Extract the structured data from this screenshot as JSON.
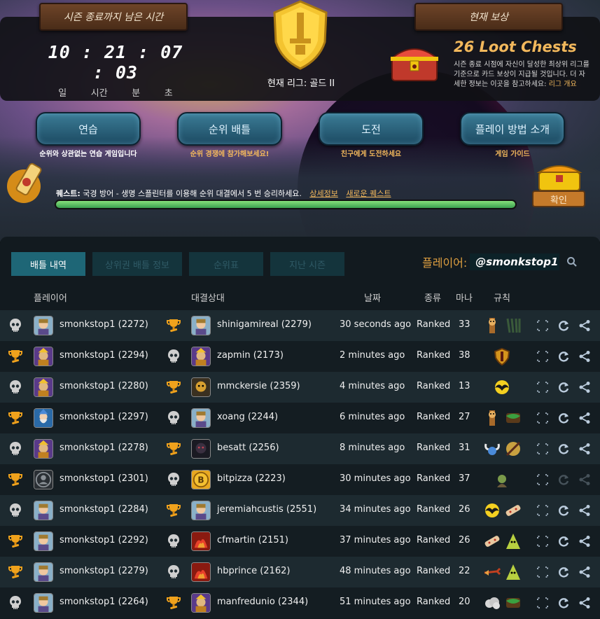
{
  "season": {
    "timer_label": "시즌 종료까지 남은 시간",
    "timer_value": "10 : 21 : 07 : 03",
    "units": [
      "일",
      "시간",
      "분",
      "초"
    ]
  },
  "league": {
    "current": "현재 리그: 골드 II"
  },
  "reward": {
    "header": "현재 보상",
    "title": "26 Loot Chests",
    "desc": "시즌 종료 시점에 자신이 달성한 최상위 리그를 기준으로 카드 보상이 지급될 것입니다. 더 자세한 정보는 이곳을 참고하세요: ",
    "link": "리그 개요"
  },
  "modes": [
    {
      "label": "연습",
      "desc": "순위와 상관없는 연습 게임입니다",
      "desc_color": "#ffffff"
    },
    {
      "label": "순위 배틀",
      "desc": "순위 경쟁에 참가해보세요!",
      "desc_color": "#f2b85c"
    },
    {
      "label": "도전",
      "desc": "친구에게 도전하세요",
      "desc_color": "#f2b85c"
    },
    {
      "label": "플레이 방법 소개",
      "desc": "게임 가이드",
      "desc_color": "#f2b85c"
    }
  ],
  "quest": {
    "label": "퀘스트:",
    "text": "국경 방어 - 생명 스플린터를 이용해 순위 대결에서 5 번 승리하세요.",
    "details_link": "상세정보",
    "new_link": "새로운 퀘스트",
    "progress": 1.0,
    "claim_label": "확인"
  },
  "tabs": [
    "배틀 내역",
    "상위권 배틀 정보",
    "순위표",
    "지난 시즌"
  ],
  "player_search": {
    "label": "플레이어:",
    "value": "@smonkstop1"
  },
  "table": {
    "headers": {
      "player": "플레이어",
      "opponent": "대결상대",
      "date": "날짜",
      "type": "종류",
      "mana": "마나",
      "rules": "규칙"
    },
    "rows": [
      {
        "player_result": "loss",
        "player": "smonkstop1 (2272)",
        "player_avatar": "knight",
        "opp_result": "win",
        "opponent": "shinigamireal (2279)",
        "opp_avatar": "knight",
        "date": "30 seconds ago",
        "type": "Ranked",
        "mana": "33",
        "rules": [
          "totem",
          "claws"
        ],
        "share_enabled": true
      },
      {
        "player_result": "win",
        "player": "smonkstop1 (2294)",
        "player_avatar": "mage",
        "opp_result": "loss",
        "opponent": "zapmin (2173)",
        "opp_avatar": "mage",
        "date": "2 minutes ago",
        "type": "Ranked",
        "mana": "38",
        "rules": [
          "shield"
        ],
        "share_enabled": true
      },
      {
        "player_result": "loss",
        "player": "smonkstop1 (2280)",
        "player_avatar": "mage",
        "opp_result": "win",
        "opponent": "mmckersie (2359)",
        "opp_avatar": "rogue",
        "date": "4 minutes ago",
        "type": "Ranked",
        "mana": "13",
        "rules": [
          "bat"
        ],
        "share_enabled": true
      },
      {
        "player_result": "win",
        "player": "smonkstop1 (2297)",
        "player_avatar": "wizard",
        "opp_result": "loss",
        "opponent": "xoang (2244)",
        "opp_avatar": "knight",
        "date": "6 minutes ago",
        "type": "Ranked",
        "mana": "27",
        "rules": [
          "totem",
          "vines"
        ],
        "share_enabled": true
      },
      {
        "player_result": "loss",
        "player": "smonkstop1 (2278)",
        "player_avatar": "mage",
        "opp_result": "win",
        "opponent": "besatt (2256)",
        "opp_avatar": "dark",
        "date": "8 minutes ago",
        "type": "Ranked",
        "mana": "31",
        "rules": [
          "horns",
          "noarmor"
        ],
        "share_enabled": true
      },
      {
        "player_result": "win",
        "player": "smonkstop1 (2301)",
        "player_avatar": "blank",
        "opp_result": "loss",
        "opponent": "bitpizza (2223)",
        "opp_avatar": "coin",
        "date": "30 minutes ago",
        "type": "Ranked",
        "mana": "37",
        "rules": [
          "goblin"
        ],
        "share_enabled": false
      },
      {
        "player_result": "loss",
        "player": "smonkstop1 (2284)",
        "player_avatar": "knight",
        "opp_result": "win",
        "opponent": "jeremiahcustis (2551)",
        "opp_avatar": "knight",
        "date": "34 minutes ago",
        "type": "Ranked",
        "mana": "26",
        "rules": [
          "bat",
          "bandage"
        ],
        "share_enabled": true
      },
      {
        "player_result": "win",
        "player": "smonkstop1 (2292)",
        "player_avatar": "knight",
        "opp_result": "loss",
        "opponent": "cfmartin (2151)",
        "opp_avatar": "fire",
        "date": "37 minutes ago",
        "type": "Ranked",
        "mana": "26",
        "rules": [
          "bandage",
          "ghost"
        ],
        "share_enabled": true
      },
      {
        "player_result": "win",
        "player": "smonkstop1 (2279)",
        "player_avatar": "knight",
        "opp_result": "loss",
        "opponent": "hbprince (2162)",
        "opp_avatar": "fire",
        "date": "48 minutes ago",
        "type": "Ranked",
        "mana": "22",
        "rules": [
          "arrow",
          "ghost"
        ],
        "share_enabled": true
      },
      {
        "player_result": "loss",
        "player": "smonkstop1 (2264)",
        "player_avatar": "knight",
        "opp_result": "win",
        "opponent": "manfredunio (2344)",
        "opp_avatar": "mage",
        "date": "51 minutes ago",
        "type": "Ranked",
        "mana": "20",
        "rules": [
          "cloud",
          "vines"
        ],
        "share_enabled": true
      }
    ]
  },
  "colors": {
    "accent": "#f2b85c",
    "tab_active": "#1e6676",
    "progress": "#3aa050"
  }
}
